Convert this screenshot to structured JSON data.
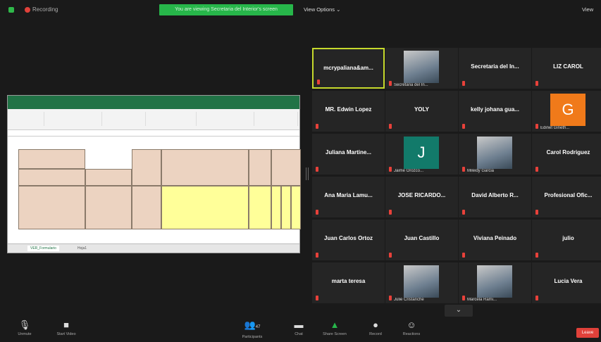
{
  "topbar": {
    "recording_label": "Recording",
    "share_banner": "You are viewing Secretaria del Interior's screen",
    "view_options": "View Options ⌄",
    "view_button": "View"
  },
  "spreadsheet": {
    "sheet_tabs": [
      "VER_Formulario",
      "Hoja1"
    ]
  },
  "gallery": {
    "tiles": [
      {
        "name": "mcrypaliana&am...",
        "active": true
      },
      {
        "photo_caption": "Secretaria del In..."
      },
      {
        "name": "Secretaria del In..."
      },
      {
        "name": "LIZ CAROL"
      },
      {
        "name": "MR. Edwin Lopez"
      },
      {
        "name": "YOLY"
      },
      {
        "name": "kelly johana gua..."
      },
      {
        "letter": "G",
        "photo_caption": "Edinet Gineth..."
      },
      {
        "name": "Juliana Martine..."
      },
      {
        "letter": "J",
        "photo_caption": "Jaime Orozco..."
      },
      {
        "photo_caption": "Mileidy Garcia"
      },
      {
        "name": "Carol Rodriguez"
      },
      {
        "name": "Ana Maria Lamu..."
      },
      {
        "name": "JOSE RICARDO..."
      },
      {
        "name": "David Alberto R..."
      },
      {
        "name": "Profesional Ofic..."
      },
      {
        "name": "Juan Carlos Ortoz"
      },
      {
        "name": "Juan Castillo"
      },
      {
        "name": "Viviana Peinado"
      },
      {
        "name": "julio"
      },
      {
        "name": "marta teresa"
      },
      {
        "photo_caption": "Julie Cristanche"
      },
      {
        "photo_caption": "Marcela Rami..."
      },
      {
        "name": "Lucia Vera"
      }
    ],
    "more_chevron": "⌄"
  },
  "toolbar": {
    "mute": "Unmute",
    "video": "Start Video",
    "participants": "Participants",
    "participants_count": "47",
    "chat": "Chat",
    "share": "Share Screen",
    "record": "Record",
    "reactions": "Reactions",
    "leave": "Leave"
  },
  "colors": {
    "accent_green": "#27b64a",
    "active_speaker": "#c6d92c",
    "muted_red": "#e8413a",
    "letter_G": "#f07a1a",
    "letter_J": "#127a6a"
  }
}
